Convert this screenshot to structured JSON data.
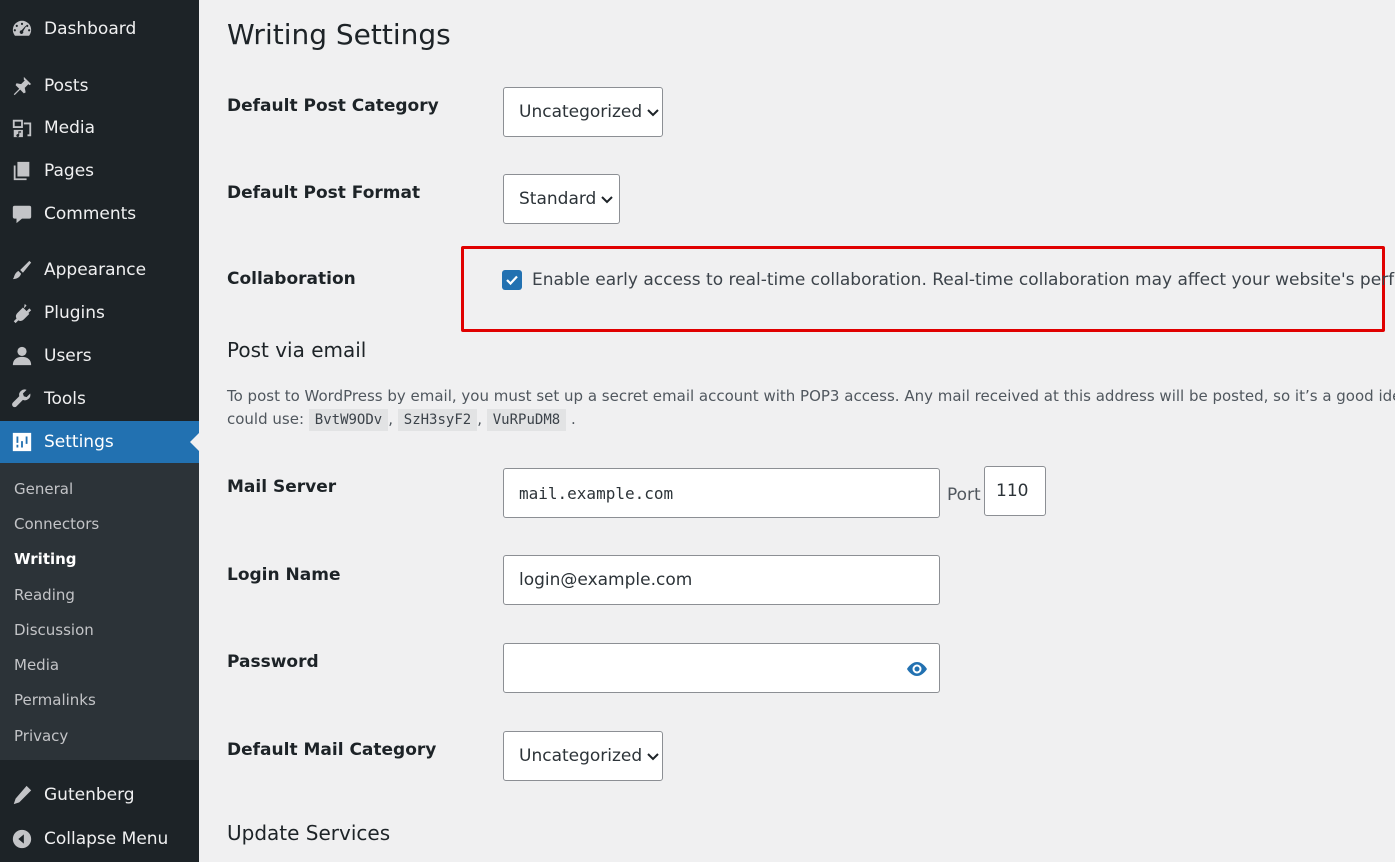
{
  "sidebar": {
    "items": [
      {
        "label": "Dashboard",
        "icon": "dashboard-icon"
      },
      {
        "label": "Posts",
        "icon": "pin-icon"
      },
      {
        "label": "Media",
        "icon": "media-icon"
      },
      {
        "label": "Pages",
        "icon": "pages-icon"
      },
      {
        "label": "Comments",
        "icon": "comment-icon"
      },
      {
        "label": "Appearance",
        "icon": "brush-icon"
      },
      {
        "label": "Plugins",
        "icon": "plug-icon"
      },
      {
        "label": "Users",
        "icon": "user-icon"
      },
      {
        "label": "Tools",
        "icon": "wrench-icon"
      },
      {
        "label": "Settings",
        "icon": "sliders-icon"
      },
      {
        "label": "Gutenberg",
        "icon": "pencil-icon"
      },
      {
        "label": "Collapse Menu",
        "icon": "collapse-icon"
      }
    ],
    "submenu": [
      "General",
      "Connectors",
      "Writing",
      "Reading",
      "Discussion",
      "Media",
      "Permalinks",
      "Privacy"
    ],
    "active_color": "#2271b1"
  },
  "page": {
    "title": "Writing Settings"
  },
  "writing": {
    "default_category_label": "Default Post Category",
    "default_category_value": "Uncategorized",
    "default_format_label": "Default Post Format",
    "default_format_value": "Standard",
    "collaboration_label": "Collaboration",
    "collaboration_checkbox_text": "Enable early access to real-time collaboration. Real-time collaboration may affect your website's performance.",
    "collaboration_checked": true,
    "highlight_color": "#e00000"
  },
  "post_via_email": {
    "heading": "Post via email",
    "description_line1": "To post to WordPress by email, you must set up a secret email account with POP3 access. Any mail received at this address will be posted, so it’s a good idea to keep this address very secret. Here are three random strings you",
    "description_prefix": "could use:",
    "codes": [
      "BvtW9ODv",
      "SzH3syF2",
      "VuRPuDM8"
    ],
    "mail_server_label": "Mail Server",
    "mail_server_value": "mail.example.com",
    "port_label": "Port",
    "port_value": "110",
    "login_label": "Login Name",
    "login_value": "login@example.com",
    "password_label": "Password",
    "password_value": "",
    "mail_category_label": "Default Mail Category",
    "mail_category_value": "Uncategorized"
  },
  "update_services": {
    "heading": "Update Services"
  }
}
